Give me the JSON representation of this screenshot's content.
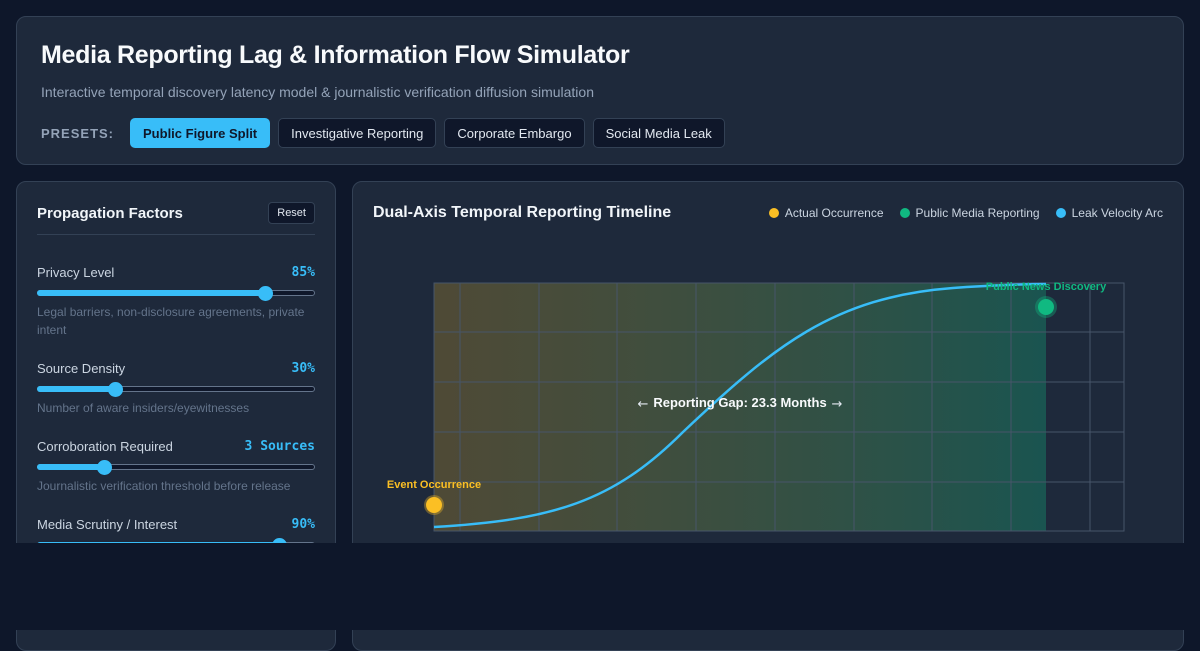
{
  "header": {
    "title": "Media Reporting Lag & Information Flow Simulator",
    "subtitle": "Interactive temporal discovery latency model & journalistic verification diffusion simulation",
    "presets_label": "PRESETS:",
    "presets": [
      "Public Figure Split",
      "Investigative Reporting",
      "Corporate Embargo",
      "Social Media Leak"
    ]
  },
  "factors": {
    "title": "Propagation Factors",
    "reset_label": "Reset",
    "items": [
      {
        "label": "Privacy Level",
        "value": "85%",
        "level": 0.82,
        "desc": "Legal barriers, non-disclosure agreements, private intent"
      },
      {
        "label": "Source Density",
        "value": "30%",
        "level": 0.28,
        "desc": "Number of aware insiders/eyewitnesses"
      },
      {
        "label": "Corroboration Required",
        "value": "3 Sources",
        "level": 0.24,
        "desc": "Journalistic verification threshold before release"
      },
      {
        "label": "Media Scrutiny / Interest",
        "value": "90%",
        "level": 0.87,
        "desc": ""
      }
    ]
  },
  "chart": {
    "title": "Dual-Axis Temporal Reporting Timeline",
    "legend": [
      {
        "label": "Actual Occurrence",
        "color": "#fbbf24"
      },
      {
        "label": "Public Media Reporting",
        "color": "#10b981"
      },
      {
        "label": "Leak Velocity Arc",
        "color": "#38bdf8"
      }
    ],
    "event_label": "Event Occurrence",
    "discovery_label": "Public News Discovery",
    "gap_label": "Reporting Gap: 23.3 Months",
    "gap_months": 23.3
  },
  "colors": {
    "accent": "#38bdf8",
    "event": "#fbbf24",
    "discovery": "#10b981"
  }
}
